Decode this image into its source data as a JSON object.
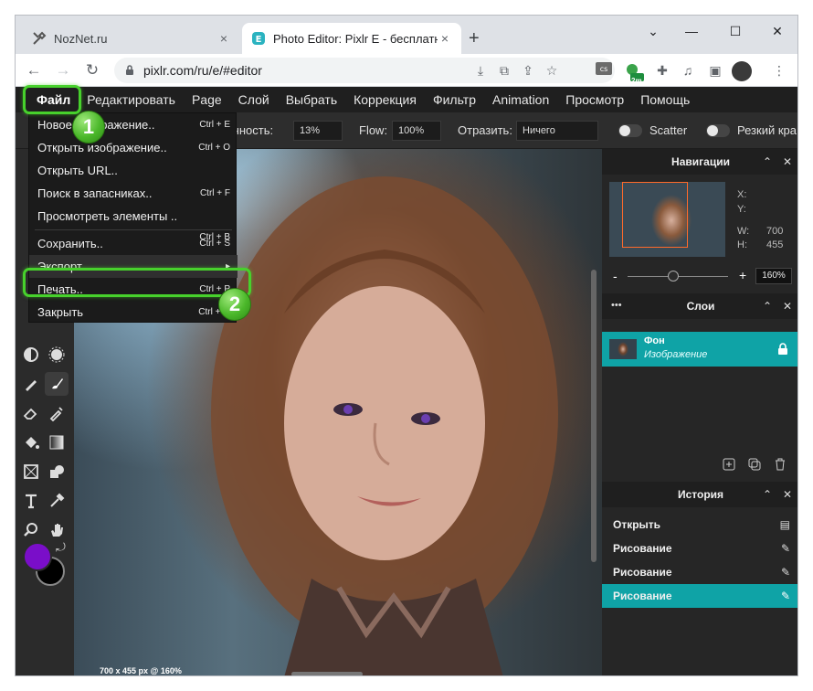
{
  "browser": {
    "tabs": [
      {
        "title": "NozNet.ru",
        "close": "×"
      },
      {
        "title": "Photo Editor: Pixlr E - бесплатный",
        "close": "×"
      }
    ],
    "new_tab": "+",
    "window_controls": {
      "down": "⌄",
      "minimize": "—",
      "maximize": "☐",
      "close": "✕"
    },
    "url": "pixlr.com/ru/e/#editor",
    "extension_badge": "2m"
  },
  "menubar": [
    "Файл",
    "Редактировать",
    "Page",
    "Слой",
    "Выбрать",
    "Коррекция",
    "Фильтр",
    "Animation",
    "Просмотр",
    "Помощь"
  ],
  "options": {
    "opacity_label": "Непрозрачность:",
    "opacity_value": "13%",
    "flow_label": "Flow:",
    "flow_value": "100%",
    "reflect_label": "Отразить:",
    "reflect_value": "Ничего",
    "scatter_label": "Scatter",
    "sharp_label": "Резкий кра"
  },
  "file_menu": [
    {
      "label": "Новое изображение..",
      "shortcut": "Ctrl + E"
    },
    {
      "label": "Открыть изображение..",
      "shortcut": "Ctrl + O"
    },
    {
      "label": "Открыть URL..",
      "shortcut": ""
    },
    {
      "label": "Поиск в запасниках..",
      "shortcut": "Ctrl + F"
    },
    {
      "label": "Просмотреть элементы ..",
      "shortcut": ""
    },
    {
      "label": "Сохранить..",
      "shortcut": "Ctrl + S"
    },
    {
      "label": "Экспорт",
      "shortcut": "▸"
    },
    {
      "label": "Печать..",
      "shortcut": "Ctrl + P"
    },
    {
      "label": "Закрыть",
      "shortcut": "Ctrl + Q"
    }
  ],
  "file_menu_save_shortcut2": "Ctrl + B",
  "callouts": {
    "one": "1",
    "two": "2"
  },
  "canvas_info": "700 x 455 px @ 160%",
  "navigator": {
    "title": "Навигации",
    "x_label": "X:",
    "y_label": "Y:",
    "w_label": "W:",
    "w_value": "700",
    "h_label": "H:",
    "h_value": "455",
    "zoom": "160%",
    "minus": "-",
    "plus": "+"
  },
  "layers": {
    "title": "Слои",
    "dots": "•••",
    "layer_name": "Фон",
    "layer_sub": "Изображение"
  },
  "history": {
    "title": "История",
    "items": [
      "Открыть",
      "Рисование",
      "Рисование",
      "Рисование"
    ]
  },
  "panel_ctrl": {
    "collapse": "⌃",
    "close": "✕"
  },
  "colors": {
    "accent": "#0fa3a6",
    "highlight": "#47d12c",
    "foreground_swatch": "#7a0ec9",
    "background_swatch": "#000000"
  }
}
